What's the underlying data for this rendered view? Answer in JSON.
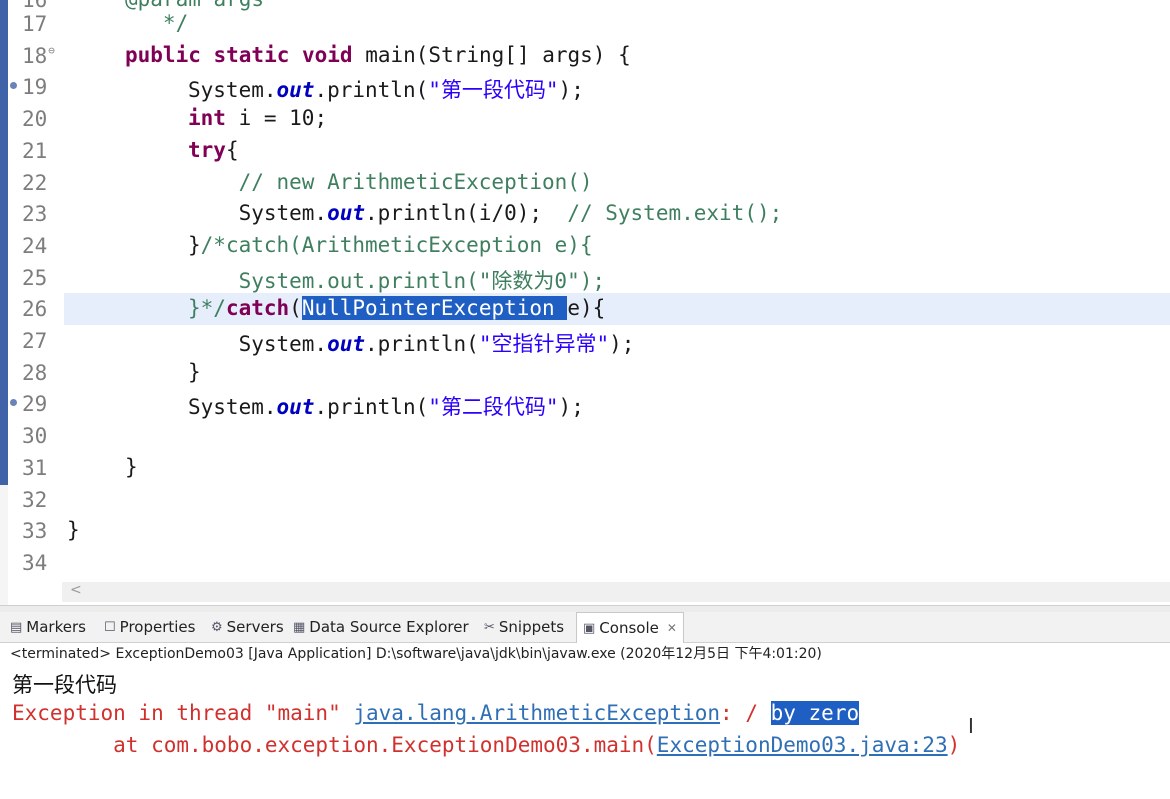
{
  "editor": {
    "partial_top_text": "@param args",
    "lines": [
      {
        "num": "17",
        "parts": [
          {
            "t": "   */",
            "c": "cmt"
          }
        ]
      },
      {
        "num": "18",
        "fold": "⊖",
        "parts": [
          {
            "t": "public static void",
            "c": "kw"
          },
          {
            "t": " main(String[] args) {",
            "c": ""
          }
        ]
      },
      {
        "num": "19",
        "marker": true,
        "parts": [
          {
            "t": "System.",
            "c": ""
          },
          {
            "t": "out",
            "c": "fld"
          },
          {
            "t": ".println(",
            "c": ""
          },
          {
            "t": "\"第一段代码\"",
            "c": "str"
          },
          {
            "t": ");",
            "c": ""
          }
        ]
      },
      {
        "num": "20",
        "parts": [
          {
            "t": "int",
            "c": "kw"
          },
          {
            "t": " i = 10;",
            "c": ""
          }
        ]
      },
      {
        "num": "21",
        "parts": [
          {
            "t": "try",
            "c": "kw"
          },
          {
            "t": "{",
            "c": ""
          }
        ]
      },
      {
        "num": "22",
        "parts": [
          {
            "t": "    // new ArithmeticException()",
            "c": "cmt"
          }
        ]
      },
      {
        "num": "23",
        "parts": [
          {
            "t": "    System.",
            "c": ""
          },
          {
            "t": "out",
            "c": "fld"
          },
          {
            "t": ".println(i/0);  ",
            "c": ""
          },
          {
            "t": "// System.exit();",
            "c": "cmt"
          }
        ]
      },
      {
        "num": "24",
        "parts": [
          {
            "t": "}",
            "c": ""
          },
          {
            "t": "/*catch(ArithmeticException e){",
            "c": "cmt"
          }
        ]
      },
      {
        "num": "25",
        "parts": [
          {
            "t": "    System.out.println(\"除数为0\");",
            "c": "cmt"
          }
        ]
      },
      {
        "num": "26",
        "current": true,
        "parts": [
          {
            "t": "}*/",
            "c": "cmt"
          },
          {
            "t": "catch",
            "c": "kw"
          },
          {
            "t": "(",
            "c": ""
          },
          {
            "t": "NullPointerException ",
            "c": "sel"
          },
          {
            "t": "e){",
            "c": ""
          }
        ]
      },
      {
        "num": "27",
        "parts": [
          {
            "t": "    System.",
            "c": ""
          },
          {
            "t": "out",
            "c": "fld"
          },
          {
            "t": ".println(",
            "c": ""
          },
          {
            "t": "\"空指针异常\"",
            "c": "str"
          },
          {
            "t": ");",
            "c": ""
          }
        ]
      },
      {
        "num": "28",
        "parts": [
          {
            "t": "}",
            "c": ""
          }
        ]
      },
      {
        "num": "29",
        "marker": true,
        "parts": [
          {
            "t": "System.",
            "c": ""
          },
          {
            "t": "out",
            "c": "fld"
          },
          {
            "t": ".println(",
            "c": ""
          },
          {
            "t": "\"第二段代码\"",
            "c": "str"
          },
          {
            "t": ");",
            "c": ""
          }
        ]
      },
      {
        "num": "30",
        "parts": []
      },
      {
        "num": "31",
        "parts": [
          {
            "t": "}",
            "c": ""
          }
        ]
      },
      {
        "num": "32",
        "parts": []
      },
      {
        "num": "33",
        "parts": [
          {
            "t": "}",
            "c": ""
          }
        ]
      },
      {
        "num": "34",
        "parts": []
      }
    ],
    "scroll_arrow": "<"
  },
  "tabs": [
    {
      "label": "Markers",
      "icon": "▤"
    },
    {
      "label": "Properties",
      "icon": "☐"
    },
    {
      "label": "Servers",
      "icon": "⚙"
    },
    {
      "label": "Data Source Explorer",
      "icon": "▦"
    },
    {
      "label": "Snippets",
      "icon": "✂"
    },
    {
      "label": "Console",
      "icon": "▣",
      "active": true,
      "close": "✕"
    }
  ],
  "console": {
    "status": "<terminated> ExceptionDemo03 [Java Application] D:\\software\\java\\jdk\\bin\\javaw.exe (2020年12月5日 下午4:01:20)",
    "out1": "第一段代码",
    "err_prefix": "Exception in thread \"main\" ",
    "err_class": "java.lang.ArithmeticException",
    "err_colon": ": / ",
    "err_msg": "by zero",
    "stack_prefix": "        at com.bobo.exception.ExceptionDemo03.main(",
    "stack_link": "ExceptionDemo03.java:23",
    "stack_suffix": ")"
  },
  "colors": {
    "keyword": "#7f0055",
    "string": "#2a00ff",
    "comment": "#3f7f5f",
    "error": "#d0312d",
    "link": "#2f6fb5"
  }
}
